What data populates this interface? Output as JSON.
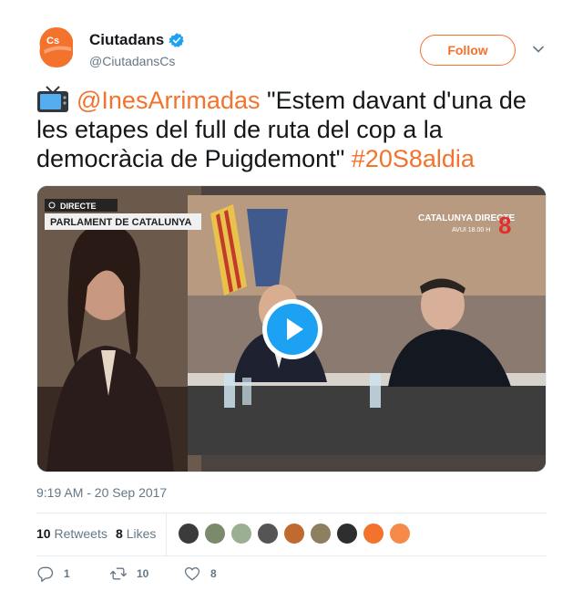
{
  "account": {
    "display_name": "Ciutadans",
    "handle": "@CiutadansCs",
    "avatar_text": "Cs",
    "avatar_subtext": "Ciutadans",
    "follow_label": "Follow"
  },
  "tweet": {
    "mention": "@InesArrimadas",
    "quote": " \"Estem davant d'una de les etapes del full de ruta del cop a la democràcia de Puigdemont\" ",
    "hashtag": "#20S8aldia",
    "icon": "tv-icon"
  },
  "video": {
    "live_label": "DIRECTE",
    "lower_third": "PARLAMENT DE CATALUNYA",
    "channel_label": "CATALUNYA DIRECTE",
    "channel_sub": "AVUI 18.00 H",
    "channel_number": "8"
  },
  "timestamp": "9:19 AM - 20 Sep 2017",
  "stats": {
    "retweets_count": "10",
    "retweets_label": "Retweets",
    "likes_count": "8",
    "likes_label": "Likes"
  },
  "actions": {
    "reply_count": "1",
    "retweet_count": "10",
    "like_count": "8"
  },
  "colors": {
    "accent": "#f3722c",
    "verified": "#1da1f2",
    "secondary_text": "#657786"
  }
}
